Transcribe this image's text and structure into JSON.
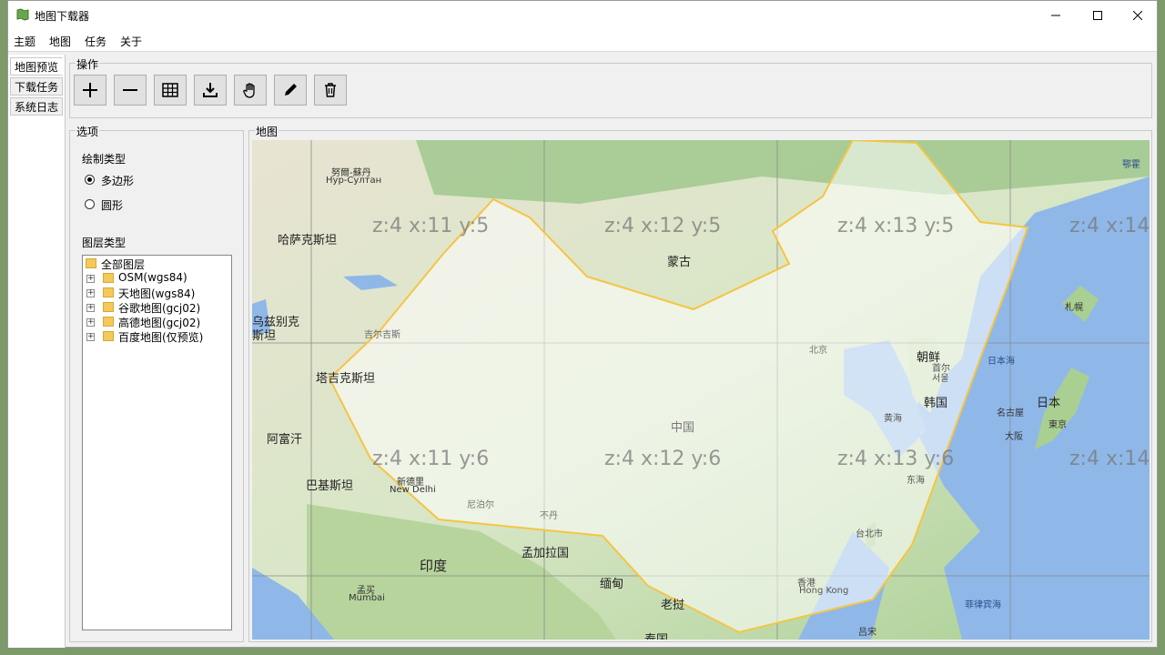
{
  "window": {
    "title": "地图下载器"
  },
  "menu": [
    "主题",
    "地图",
    "任务",
    "关于"
  ],
  "side_tabs": [
    "地图预览",
    "下载任务",
    "系统日志"
  ],
  "operations": {
    "label": "操作",
    "tools": [
      "zoom-in-icon",
      "zoom-out-icon",
      "grid-icon",
      "download-icon",
      "hand-icon",
      "pencil-icon",
      "trash-icon"
    ]
  },
  "options": {
    "label": "选项",
    "draw_type_label": "绘制类型",
    "draw_types": [
      "多边形",
      "圆形"
    ],
    "draw_type_selected": "多边形",
    "layer_type_label": "图层类型",
    "layers_root": "全部图层",
    "layers": [
      "OSM(wgs84)",
      "天地图(wgs84)",
      "谷歌地图(gcj02)",
      "高德地图(gcj02)",
      "百度地图(仅预览)"
    ]
  },
  "map": {
    "label": "地图",
    "tile_labels": [
      "z:4 x:11 y:5",
      "z:4 x:12 y:5",
      "z:4 x:13 y:5",
      "z:4 x:14",
      "z:4 x:11 y:6",
      "z:4 x:12 y:6",
      "z:4 x:13 y:6",
      "z:4 x:14"
    ],
    "places": {
      "nursultan_cn": "努爾-蘇丹",
      "nursultan_ru": "Нур-Султан",
      "kazakhstan": "哈萨克斯坦",
      "mongolia": "蒙古",
      "uzbekistan": "乌兹别克\n斯坦",
      "kyrgyzstan": "吉尔吉斯",
      "tajikistan": "塔吉克斯坦",
      "afghanistan": "阿富汗",
      "pakistan": "巴基斯坦",
      "newdelhi_cn": "新德里",
      "newdelhi_en": "New Delhi",
      "nepal": "尼泊尔",
      "bhutan": "不丹",
      "china": "中国",
      "beijing": "北京",
      "korea_n": "朝鲜",
      "seoul": "首尔\n서울",
      "korea_s": "韩国",
      "yellow_sea": "黄海",
      "east_sea": "东海",
      "sea_of_japan": "日本海",
      "japan": "日本",
      "tokyo": "東京",
      "nagoya": "名古屋",
      "osaka": "大阪",
      "sapporo": "札幌",
      "okhotsk": "鄂霍",
      "taipei": "台北市",
      "hongkong_cn": "香港",
      "hongkong_en": "Hong Kong",
      "philippine_sea": "菲律宾海",
      "india": "印度",
      "bangladesh": "孟加拉国",
      "myanmar": "缅甸",
      "laos": "老挝",
      "thailand": "泰国",
      "luzon": "吕宋",
      "mumbai_cn": "孟买",
      "mumbai_en": "Mumbai"
    }
  }
}
